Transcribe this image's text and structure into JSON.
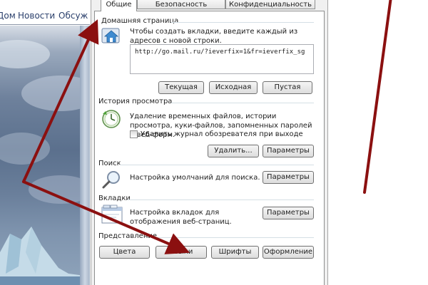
{
  "browser": {
    "nav_links": [
      "Дом",
      "Новости",
      "Обсуж"
    ]
  },
  "dialog": {
    "tabs": [
      {
        "label": "Общие",
        "active": true
      },
      {
        "label": "Безопасность",
        "active": false
      },
      {
        "label": "Конфиденциальность",
        "active": false
      }
    ],
    "home_page": {
      "title": "Домашняя страница",
      "description": "Чтобы создать вкладки, введите каждый из адресов с новой строки.",
      "url": "http://go.mail.ru/?ieverfix=1&fr=ieverfix_sg",
      "buttons": {
        "current": "Текущая",
        "default": "Исходная",
        "blank": "Пустая"
      }
    },
    "history": {
      "title": "История просмотра",
      "description": "Удаление временных файлов, истории просмотра, куки-файлов, запомненных паролей и веб-форм.",
      "checkbox_label": "Удалить журнал обозревателя при выходе",
      "checkbox_checked": false,
      "delete_button": "Удалить...",
      "settings_button": "Параметры"
    },
    "search": {
      "title": "Поиск",
      "description": "Настройка умолчаний для поиска.",
      "settings_button": "Параметры"
    },
    "tabs_section": {
      "title": "Вкладки",
      "description": "Настройка вкладок для отображения веб-страниц.",
      "settings_button": "Параметры"
    },
    "appearance": {
      "title": "Представление",
      "buttons": {
        "colors": "Цвета",
        "languages": "Языки",
        "fonts": "Шрифты",
        "accessibility": "Оформление"
      }
    }
  },
  "annotations": {
    "arrow_color": "#8b1010"
  }
}
